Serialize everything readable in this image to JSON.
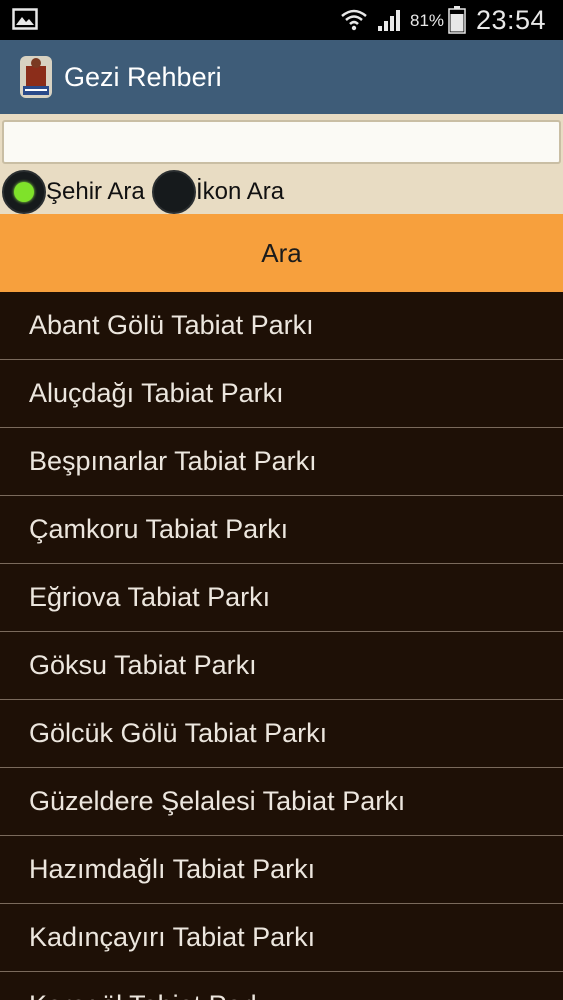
{
  "status_bar": {
    "battery_percent": "81%",
    "time": "23:54"
  },
  "app": {
    "title": "Gezi Rehberi"
  },
  "search": {
    "input_value": "",
    "options": [
      {
        "label": "Şehir Ara",
        "selected": true
      },
      {
        "label": "İkon Ara",
        "selected": false
      }
    ],
    "button_label": "Ara"
  },
  "results": [
    "Abant Gölü Tabiat Parkı",
    "Aluçdağı Tabiat Parkı",
    "Beşpınarlar Tabiat Parkı",
    "Çamkoru Tabiat Parkı",
    "Eğriova Tabiat Parkı",
    "Göksu Tabiat Parkı",
    "Gölcük Gölü Tabiat Parkı",
    "Güzeldere Şelalesi Tabiat Parkı",
    "Hazımdağlı Tabiat Parkı",
    "Kadınçayırı Tabiat Parkı",
    "Karagöl Tabiat Parkı"
  ],
  "colors": {
    "action_bar": "#3e5c78",
    "search_area": "#e8dcc3",
    "button": "#f7a03d",
    "list_background": "#1e1006",
    "radio_selected": "#7fe22a"
  }
}
